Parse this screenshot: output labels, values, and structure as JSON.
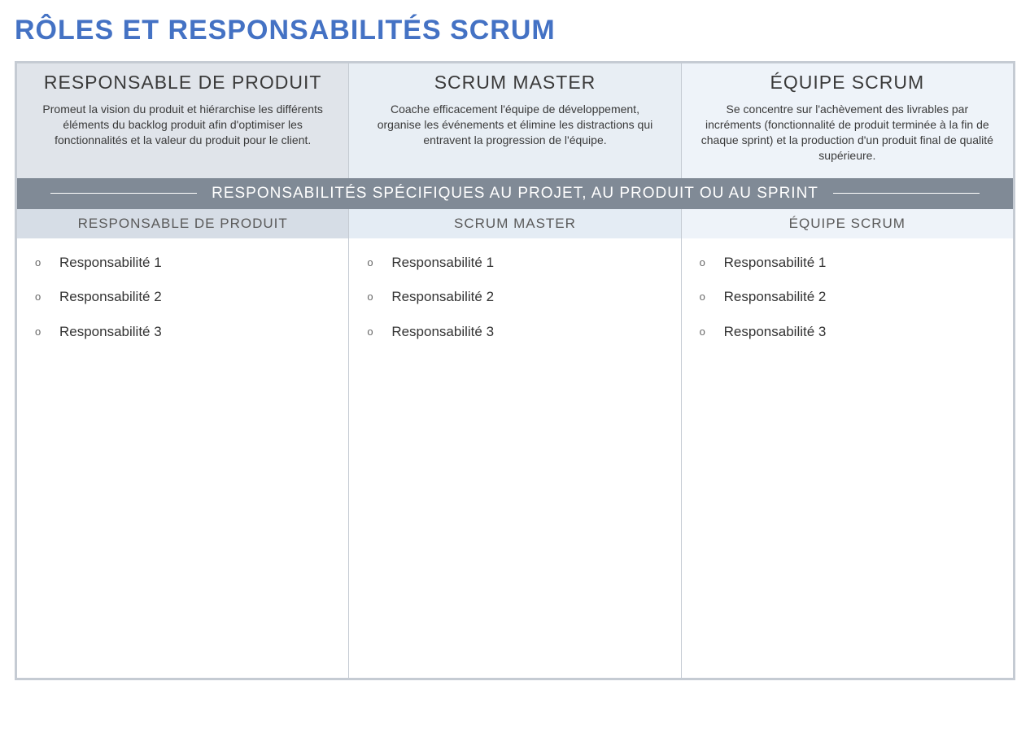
{
  "title": "RÔLES ET RESPONSABILITÉS SCRUM",
  "roles": {
    "productOwner": {
      "title": "RESPONSABLE DE PRODUIT",
      "desc": "Promeut la vision du produit et hiérarchise les différents éléments du backlog produit afin d'optimiser les fonctionnalités et la valeur du produit pour le client."
    },
    "scrumMaster": {
      "title": "SCRUM MASTER",
      "desc": "Coache efficacement l'équipe de développement, organise les événements et élimine les distractions qui entravent la progression de l'équipe."
    },
    "scrumTeam": {
      "title": "ÉQUIPE SCRUM",
      "desc": "Se concentre sur l'achèvement des livrables par incréments (fonctionnalité de produit terminée à la fin de chaque sprint) et la production d'un produit final de qualité supérieure."
    }
  },
  "bannerText": "RESPONSABILITÉS SPÉCIFIQUES AU PROJET, AU PRODUIT OU AU SPRINT",
  "subHeaders": {
    "productOwner": "RESPONSABLE DE PRODUIT",
    "scrumMaster": "SCRUM MASTER",
    "scrumTeam": "ÉQUIPE SCRUM"
  },
  "responsibilities": {
    "productOwner": [
      "Responsabilité 1",
      "Responsabilité 2",
      "Responsabilité 3"
    ],
    "scrumMaster": [
      "Responsabilité 1",
      "Responsabilité 2",
      "Responsabilité 3"
    ],
    "scrumTeam": [
      "Responsabilité 1",
      "Responsabilité 2",
      "Responsabilité 3"
    ]
  }
}
